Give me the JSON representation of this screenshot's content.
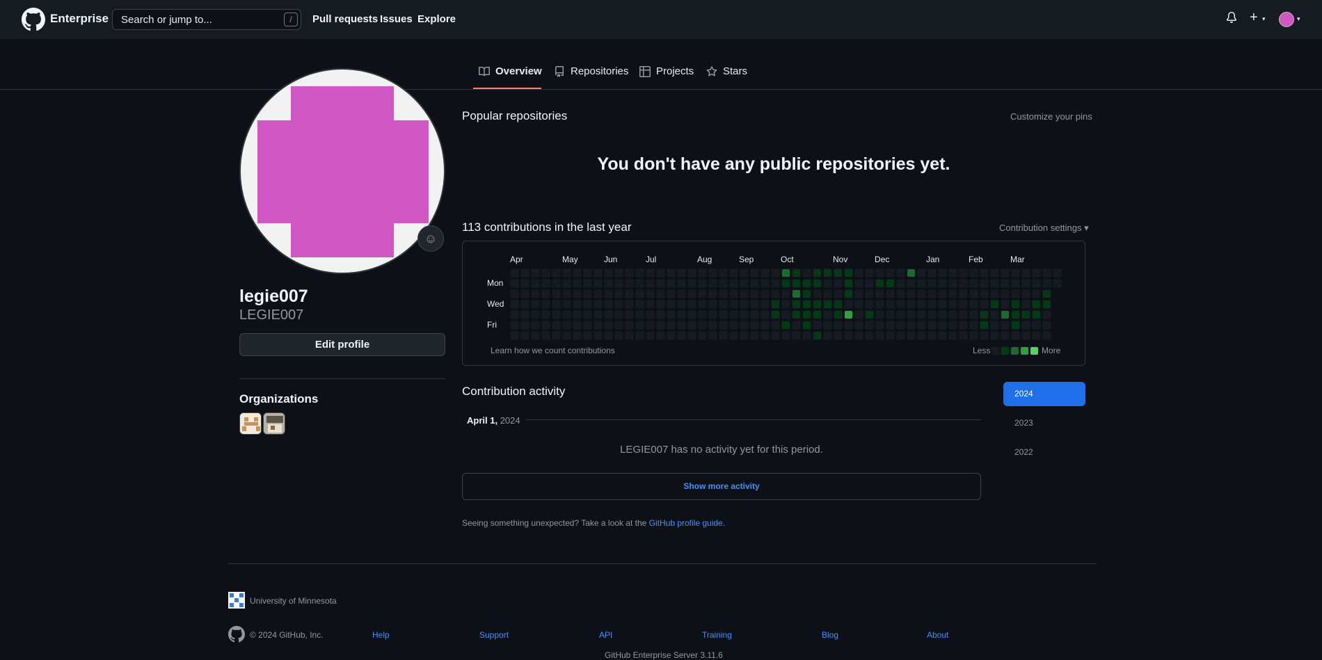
{
  "header": {
    "brand": "Enterprise",
    "search_placeholder": "Search or jump to...",
    "search_shortcut": "/",
    "nav": [
      "Pull requests",
      "Issues",
      "Explore"
    ],
    "plus_symbol": "+",
    "caret_symbol": "▾"
  },
  "tabs": [
    "Overview",
    "Repositories",
    "Projects",
    "Stars"
  ],
  "profile": {
    "name": "legie007",
    "login": "LEGIE007",
    "edit_label": "Edit profile",
    "avatar_color": "#d157c4",
    "organizations_title": "Organizations"
  },
  "popular": {
    "title": "Popular repositories",
    "customize": "Customize your pins",
    "empty": "You don't have any public repositories yet."
  },
  "contributions": {
    "title": "113 contributions in the last year",
    "settings": "Contribution settings ▾",
    "months": [
      "Apr",
      "May",
      "Jun",
      "Jul",
      "Aug",
      "Sep",
      "Oct",
      "Nov",
      "Dec",
      "Jan",
      "Feb",
      "Mar"
    ],
    "days": [
      "Mon",
      "Wed",
      "Fri"
    ],
    "learn": "Learn how we count contributions",
    "less": "Less",
    "more": "More",
    "level_colors": [
      "#151b23",
      "#033a16",
      "#196c2e",
      "#2ea043",
      "#56d364"
    ]
  },
  "activity": {
    "title": "Contribution activity",
    "date_bold": "April 1,",
    "date_year": "2024",
    "no_activity": "LEGIE007 has no activity yet for this period.",
    "more_button": "Show more activity",
    "guide_prefix": "Seeing something unexpected? Take a look at the",
    "guide_link": "GitHub profile guide",
    "guide_suffix": ".",
    "years": [
      "2024",
      "2023",
      "2022"
    ]
  },
  "footer": {
    "org": "University of Minnesota",
    "copyright": "© 2024 GitHub, Inc.",
    "links": [
      "Help",
      "Support",
      "API",
      "Training",
      "Blog",
      "About"
    ],
    "server": "GitHub Enterprise Server 3.11.6"
  }
}
